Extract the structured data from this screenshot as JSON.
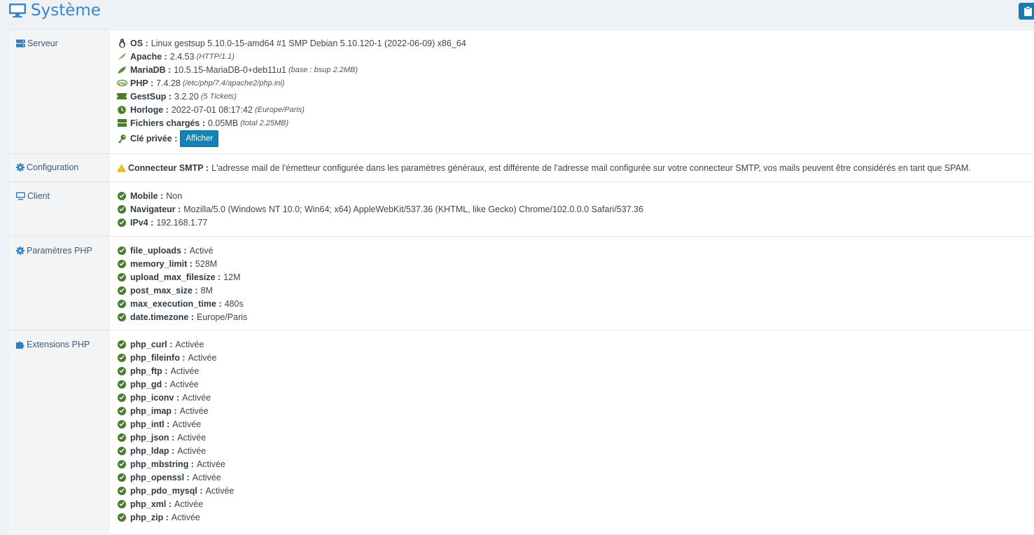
{
  "page": {
    "title": "Système"
  },
  "colors": {
    "accent": "#3a87c8",
    "check_green": "#4a7c2a",
    "warning": "#f0ad00",
    "button": "#1383b5"
  },
  "server": {
    "label": "Serveur",
    "items": [
      {
        "key": "OS :",
        "value": "Linux gestsup 5.10.0-15-amd64 #1 SMP Debian 5.10.120-1 (2022-06-09) x86_64",
        "note": "",
        "icon": "linux-icon"
      },
      {
        "key": "Apache :",
        "value": "2.4.53",
        "note": "(HTTP/1.1)",
        "icon": "feather-icon"
      },
      {
        "key": "MariaDB :",
        "value": "10.5.15-MariaDB-0+deb11u1",
        "note": "(base : bsup 2.2MB)",
        "icon": "leaf-icon"
      },
      {
        "key": "PHP :",
        "value": "7.4.28",
        "note": "(/etc/php/7.4/apache2/php.ini)",
        "icon": "php-icon"
      },
      {
        "key": "GestSup :",
        "value": "3.2.20",
        "note": "(5 Tickets)",
        "icon": "ticket-icon"
      },
      {
        "key": "Horloge :",
        "value": "2022-07-01 08:17:42",
        "note": "(Europe/Paris)",
        "icon": "clock-icon"
      },
      {
        "key": "Fichiers chargés :",
        "value": "0.05MB",
        "note": "(total 2.25MB)",
        "icon": "hdd-icon"
      }
    ],
    "private_key": {
      "key": "Clé privée :",
      "button": "Afficher"
    }
  },
  "configuration": {
    "label": "Configuration",
    "warning_key": "Connecteur SMTP :",
    "warning_text": "L'adresse mail de l'émetteur configurée dans les paramètres généraux, est différente de l'adresse mail configurée sur votre connecteur SMTP, vos mails peuvent être considérés en tant que SPAM."
  },
  "client": {
    "label": "Client",
    "items": [
      {
        "key": "Mobile :",
        "value": "Non"
      },
      {
        "key": "Navigateur :",
        "value": "Mozilla/5.0 (Windows NT 10.0; Win64; x64) AppleWebKit/537.36 (KHTML, like Gecko) Chrome/102.0.0.0 Safari/537.36"
      },
      {
        "key": "IPv4 :",
        "value": "192.168.1.77"
      }
    ]
  },
  "php_params": {
    "label": "Paramètres PHP",
    "items": [
      {
        "key": "file_uploads :",
        "value": "Activé"
      },
      {
        "key": "memory_limit :",
        "value": "528M"
      },
      {
        "key": "upload_max_filesize :",
        "value": "12M"
      },
      {
        "key": "post_max_size :",
        "value": "8M"
      },
      {
        "key": "max_execution_time :",
        "value": "480s"
      },
      {
        "key": "date.timezone :",
        "value": "Europe/Paris"
      }
    ]
  },
  "php_extensions": {
    "label": "Extensions PHP",
    "items": [
      {
        "key": "php_curl :",
        "value": "Activée"
      },
      {
        "key": "php_fileinfo :",
        "value": "Activée"
      },
      {
        "key": "php_ftp :",
        "value": "Activée"
      },
      {
        "key": "php_gd :",
        "value": "Activée"
      },
      {
        "key": "php_iconv :",
        "value": "Activée"
      },
      {
        "key": "php_imap :",
        "value": "Activée"
      },
      {
        "key": "php_intl :",
        "value": "Activée"
      },
      {
        "key": "php_json :",
        "value": "Activée"
      },
      {
        "key": "php_ldap :",
        "value": "Activée"
      },
      {
        "key": "php_mbstring :",
        "value": "Activée"
      },
      {
        "key": "php_openssl :",
        "value": "Activée"
      },
      {
        "key": "php_pdo_mysql :",
        "value": "Activée"
      },
      {
        "key": "php_xml :",
        "value": "Activée"
      },
      {
        "key": "php_zip :",
        "value": "Activée"
      }
    ]
  }
}
